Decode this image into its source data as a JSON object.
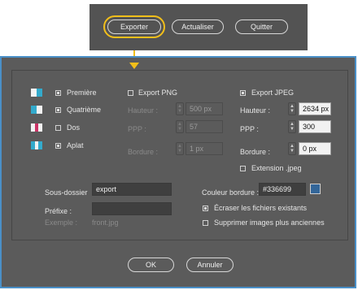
{
  "topbar": {
    "export": "Exporter",
    "refresh": "Actualiser",
    "quit": "Quitter"
  },
  "pages": [
    {
      "label": "Première",
      "checked": true,
      "colors": [
        "#f2f2f2",
        "#33aacc"
      ]
    },
    {
      "label": "Quatrième",
      "checked": true,
      "colors": [
        "#33aacc",
        "#f2f2f2"
      ]
    },
    {
      "label": "Dos",
      "checked": false,
      "colors": [
        "#f2f2f2",
        "#cc3366",
        "#f2f2f2"
      ]
    },
    {
      "label": "Aplat",
      "checked": true,
      "colors": [
        "#33aacc",
        "#f2f2f2",
        "#33aacc"
      ]
    }
  ],
  "png": {
    "label": "Export PNG",
    "checked": false,
    "height_label": "Hauteur :",
    "height_value": "500 px",
    "ppp_label": "PPP :",
    "ppp_value": "57",
    "border_label": "Bordure :",
    "border_value": "1 px"
  },
  "jpeg": {
    "label": "Export JPEG",
    "checked": true,
    "height_label": "Hauteur :",
    "height_value": "2634 px",
    "ppp_label": "PPP :",
    "ppp_value": "300",
    "border_label": "Bordure :",
    "border_value": "0 px",
    "ext_label": "Extension .jpeg",
    "ext_checked": false
  },
  "subfolder": {
    "label": "Sous-dossier",
    "value": "export"
  },
  "prefix": {
    "label": "Préfixe :",
    "value": ""
  },
  "example": {
    "label": "Exemple :",
    "value": "front.jpg"
  },
  "border_color": {
    "label": "Couleur bordure :",
    "value": "#336699",
    "swatch": "#336699"
  },
  "overwrite": {
    "label": "Écraser les fichiers existants",
    "checked": true
  },
  "delete_old": {
    "label": "Supprimer images plus anciennes",
    "checked": false
  },
  "buttons": {
    "ok": "OK",
    "cancel": "Annuler"
  }
}
